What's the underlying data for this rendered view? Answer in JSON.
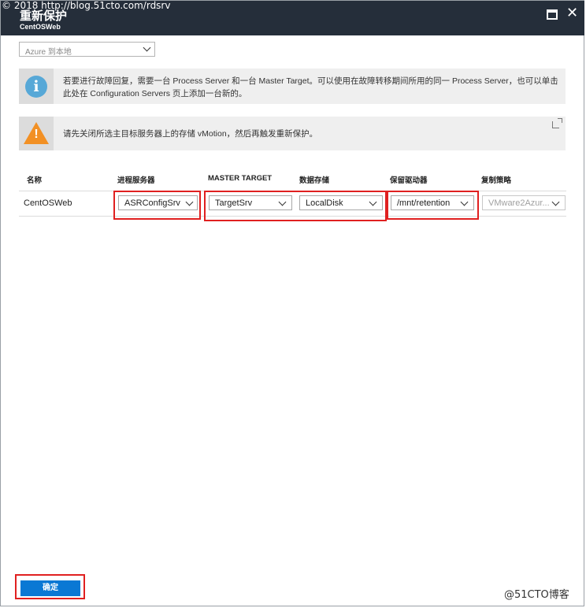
{
  "watermark": "© 2018 http://blog.51cto.com/rdsrv",
  "window": {
    "title": "重新保护",
    "subtitle": "CentOSWeb",
    "maximize_icon": "maximize-icon",
    "close_icon": "close-icon",
    "close_glyph": "✕"
  },
  "direction_select": {
    "value": "Azure 到本地"
  },
  "info_banner": {
    "icon": "info-icon",
    "glyph": "i",
    "text": "若要进行故障回复，需要一台 Process Server 和一台 Master Target。可以使用在故障转移期间所用的同一 Process Server，也可以单击此处在 Configuration Servers 页上添加一台新的。"
  },
  "warning_banner": {
    "icon": "warning-icon",
    "glyph": "!",
    "text": "请先关闭所选主目标服务器上的存储 vMotion，然后再触发重新保护。",
    "external_link_icon": "external-link-icon"
  },
  "table": {
    "headers": [
      "名称",
      "进程服务器",
      "MASTER TARGET",
      "数据存储",
      "保留驱动器",
      "复制策略"
    ],
    "row": {
      "name": "CentOSWeb",
      "process_server": "ASRConfigSrv",
      "master_target": "TargetSrv",
      "datastore": "LocalDisk",
      "retention_drive": "/mnt/retention",
      "replication_policy": "VMware2Azur..."
    }
  },
  "footer": {
    "ok_label": "确定"
  },
  "brand": "@51CTO博客",
  "colors": {
    "titlebar": "#252e3a",
    "accent": "#0a78d4",
    "highlight": "#e02020",
    "info": "#57a8d7",
    "warning": "#f29024"
  }
}
